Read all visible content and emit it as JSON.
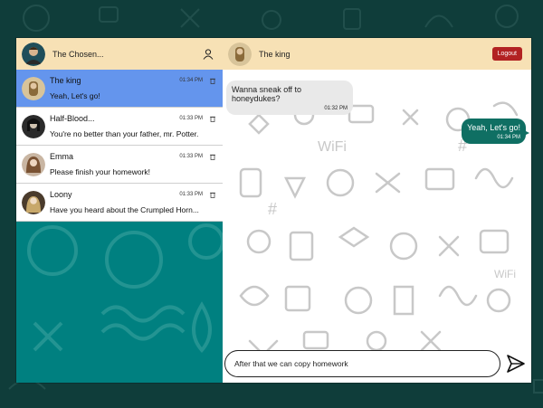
{
  "user": {
    "name": "The Chosen..."
  },
  "chats": [
    {
      "name": "The king",
      "time": "01:34 PM",
      "last": "Yeah, Let's go!",
      "active": true,
      "avatar_color": "#caa86a"
    },
    {
      "name": "Half-Blood...",
      "time": "01:33 PM",
      "last": "You're no better than your father, mr. Potter.",
      "active": false,
      "avatar_color": "#2b2b2b"
    },
    {
      "name": "Emma",
      "time": "01:33 PM",
      "last": "Please finish your homework!",
      "active": false,
      "avatar_color": "#b38b6d"
    },
    {
      "name": "Loony",
      "time": "01:33 PM",
      "last": "Have you heard about the Crumpled Horn...",
      "active": false,
      "avatar_color": "#5b4a3a"
    }
  ],
  "conversation": {
    "title": "The king",
    "logout_label": "Logout",
    "messages": [
      {
        "direction": "in",
        "text": "Wanna sneak off to honeydukes?",
        "time": "01:32 PM"
      },
      {
        "direction": "out",
        "text": "Yeah, Let's go!",
        "time": "01:34 PM"
      }
    ],
    "composer_value": "After that we can copy homework"
  },
  "colors": {
    "header": "#f7e1b5",
    "sidebar": "#008080",
    "active_chat": "#6495ed",
    "outgoing_bubble": "#0f6f63",
    "logout": "#b22222"
  },
  "icons": {
    "user": "user-icon",
    "delete": "trash-icon",
    "send": "send-icon"
  }
}
